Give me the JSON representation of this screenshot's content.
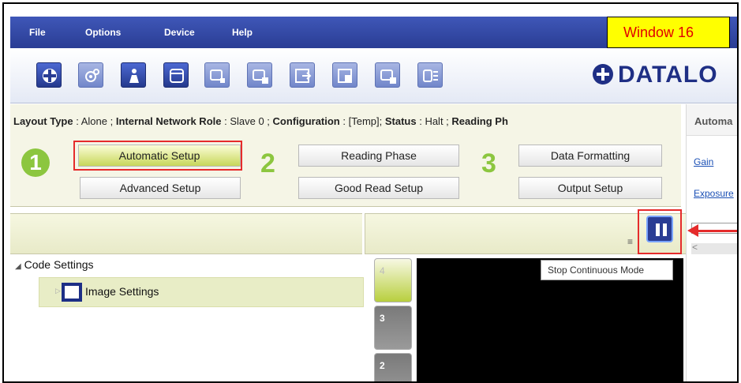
{
  "window_label": "Window 16",
  "menu": {
    "file": "File",
    "options": "Options",
    "device": "Device",
    "help": "Help"
  },
  "toolbar": {
    "icons": [
      "crosshair-icon",
      "camera-icon",
      "info-person-icon",
      "window-icon",
      "device-icon",
      "device-settings-icon",
      "export-icon",
      "import-icon",
      "device-alt-icon",
      "network-icon"
    ]
  },
  "logo": "DATALO",
  "status": {
    "layout_type_label": "Layout Type",
    "layout_type_value": "Alone ;",
    "network_role_label": "Internal Network Role",
    "network_role_value": "Slave 0 ;",
    "configuration_label": "Configuration",
    "configuration_value": "[Temp];",
    "status_label": "Status",
    "status_value": "Halt ;",
    "reading_label": "Reading Ph"
  },
  "steps": {
    "one": "1",
    "two": "2",
    "three": "3"
  },
  "setup_buttons": {
    "automatic_setup": "Automatic Setup",
    "advanced_setup": "Advanced Setup",
    "reading_phase": "Reading Phase",
    "good_read_setup": "Good Read Setup",
    "data_formatting": "Data Formatting",
    "output_setup": "Output Setup"
  },
  "right_panel": {
    "title": "Automa",
    "gain_link": "Gain",
    "exposure_link": "Exposure"
  },
  "tree": {
    "code_settings": "Code Settings",
    "image_settings": "Image Settings"
  },
  "viewer": {
    "tooltip": "Stop Continuous Mode",
    "thumbnails": [
      "4",
      "3",
      "2"
    ]
  }
}
